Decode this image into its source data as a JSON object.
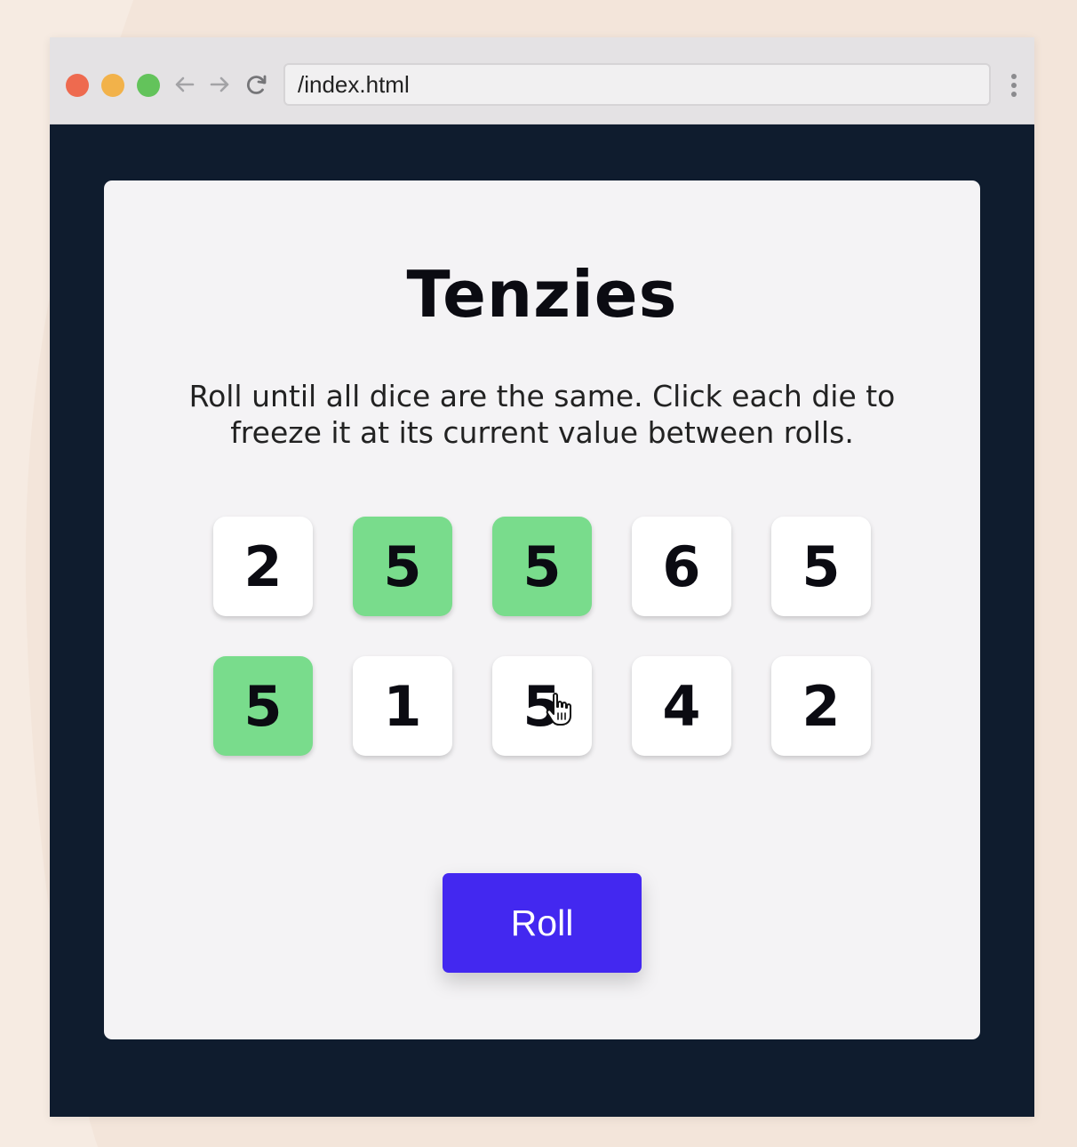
{
  "browser": {
    "url": "/index.html",
    "traffic_lights": [
      "close",
      "minimize",
      "zoom"
    ],
    "colors": {
      "close": "#ee6a4f",
      "minimize": "#f2b24a",
      "zoom": "#63c35b",
      "page_background": "#0f1c2e"
    }
  },
  "app": {
    "title": "Tenzies",
    "instructions": "Roll until all dice are the same. Click each die to freeze it at its current value between rolls.",
    "dice": [
      {
        "value": "2",
        "held": false
      },
      {
        "value": "5",
        "held": true
      },
      {
        "value": "5",
        "held": true
      },
      {
        "value": "6",
        "held": false
      },
      {
        "value": "5",
        "held": false
      },
      {
        "value": "5",
        "held": true
      },
      {
        "value": "1",
        "held": false
      },
      {
        "value": "5",
        "held": false
      },
      {
        "value": "4",
        "held": false
      },
      {
        "value": "2",
        "held": false
      }
    ],
    "roll_label": "Roll",
    "colors": {
      "held_die": "#79dc8c",
      "die": "#ffffff",
      "roll_button": "#4328f0",
      "card": "#f4f3f5"
    }
  }
}
